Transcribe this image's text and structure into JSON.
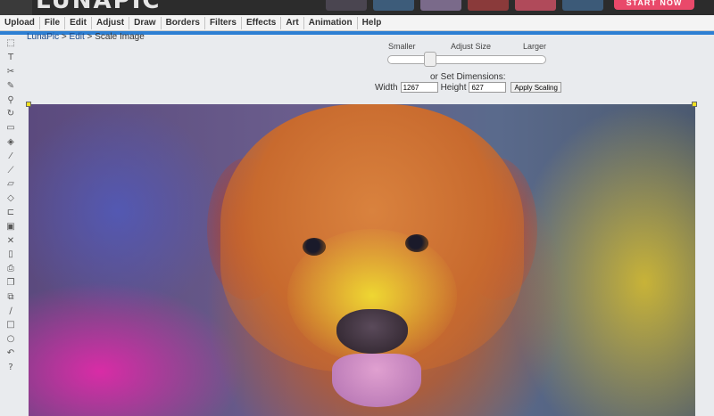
{
  "app": {
    "logo_text": "LUNAPIC",
    "start_button": "START NOW"
  },
  "menu": [
    "Upload",
    "File",
    "Edit",
    "Adjust",
    "Draw",
    "Borders",
    "Filters",
    "Effects",
    "Art",
    "Animation",
    "Help"
  ],
  "breadcrumb": {
    "home": "LunaPic",
    "sep1": " > ",
    "section": "Edit",
    "sep2": " > ",
    "current": "Scale Image"
  },
  "scale": {
    "label_smaller": "Smaller",
    "label_adjust": "Adjust Size",
    "label_larger": "Larger",
    "set_dimensions": "or Set Dimensions:",
    "width_label": "Width",
    "width_value": "1267",
    "height_label": "Height",
    "height_value": "627",
    "apply_label": "Apply Scaling",
    "slider_position": 0.25
  },
  "colors": {
    "menu_accent": "#2d7fd3",
    "start_button": "#e9496a",
    "breadcrumb_link": "#1a4a8a"
  },
  "toolbar_icons": [
    {
      "name": "select-icon",
      "glyph": "⬚"
    },
    {
      "name": "text-icon",
      "glyph": "T"
    },
    {
      "name": "scissors-icon",
      "glyph": "✂"
    },
    {
      "name": "pencil-icon",
      "glyph": "✎"
    },
    {
      "name": "magnify-icon",
      "glyph": "⚲"
    },
    {
      "name": "rotate-icon",
      "glyph": "↻"
    },
    {
      "name": "crop-icon",
      "glyph": "▭"
    },
    {
      "name": "paint-bucket-icon",
      "glyph": "◈"
    },
    {
      "name": "eyedropper-icon",
      "glyph": "⁄"
    },
    {
      "name": "brush-icon",
      "glyph": "⟋"
    },
    {
      "name": "folder-icon",
      "glyph": "▱"
    },
    {
      "name": "eraser-icon",
      "glyph": "◇"
    },
    {
      "name": "open-folder-icon",
      "glyph": "⊏"
    },
    {
      "name": "save-icon",
      "glyph": "▣"
    },
    {
      "name": "close-icon",
      "glyph": "✕"
    },
    {
      "name": "new-file-icon",
      "glyph": "▯"
    },
    {
      "name": "print-icon",
      "glyph": "⎙"
    },
    {
      "name": "layers-icon",
      "glyph": "❐"
    },
    {
      "name": "copy-icon",
      "glyph": "⧉"
    },
    {
      "name": "line-icon",
      "glyph": "∕"
    },
    {
      "name": "rectangle-icon",
      "glyph": "□"
    },
    {
      "name": "circle-icon",
      "glyph": "○"
    },
    {
      "name": "undo-icon",
      "glyph": "↶"
    },
    {
      "name": "help-icon",
      "glyph": "?"
    }
  ]
}
